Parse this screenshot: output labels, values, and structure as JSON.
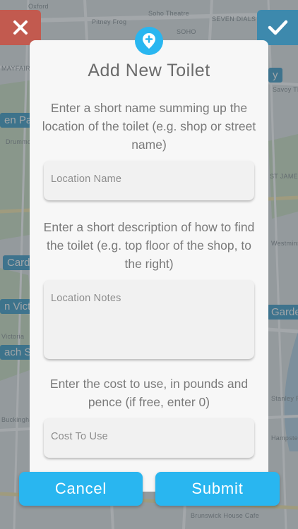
{
  "map": {
    "labels": [
      "Oxford",
      "Soho Theatre",
      "Pitney Frog",
      "SEVEN DIALS",
      "SOHO",
      "MAYFAIR",
      "ST JAMES'S",
      "Savoy Theatre",
      "Victoria",
      "Westminster Abbey",
      "Buckingham Palace",
      "Drummond",
      "Brunswick House Cafe",
      "Stanley Place",
      "Hampstead Steaks"
    ],
    "chips": [
      "en Par",
      "Card",
      "n Victo",
      "ach St",
      "y",
      "Garde"
    ]
  },
  "corner_buttons": {
    "close_icon": "close-icon",
    "confirm_icon": "check-icon",
    "close_color": "#c25a4f",
    "confirm_color": "#3d89ad"
  },
  "modal": {
    "pin_icon": "add-location-pin-icon",
    "title": "Add New Toilet",
    "name_instruction": "Enter a short name summing up the location of the toilet (e.g. shop or street name)",
    "name_placeholder": "Location Name",
    "notes_instruction": "Enter a short description of how to find the toilet (e.g. top floor of the shop, to the right)",
    "notes_placeholder": "Location Notes",
    "cost_instruction": "Enter the cost to use, in pounds and pence (if free, enter 0)",
    "cost_placeholder": "Cost To Use"
  },
  "actions": {
    "cancel_label": "Cancel",
    "submit_label": "Submit"
  },
  "colors": {
    "accent": "#29b6f0",
    "modal_bg": "#f7f7f7",
    "text": "#7a7a7a"
  }
}
